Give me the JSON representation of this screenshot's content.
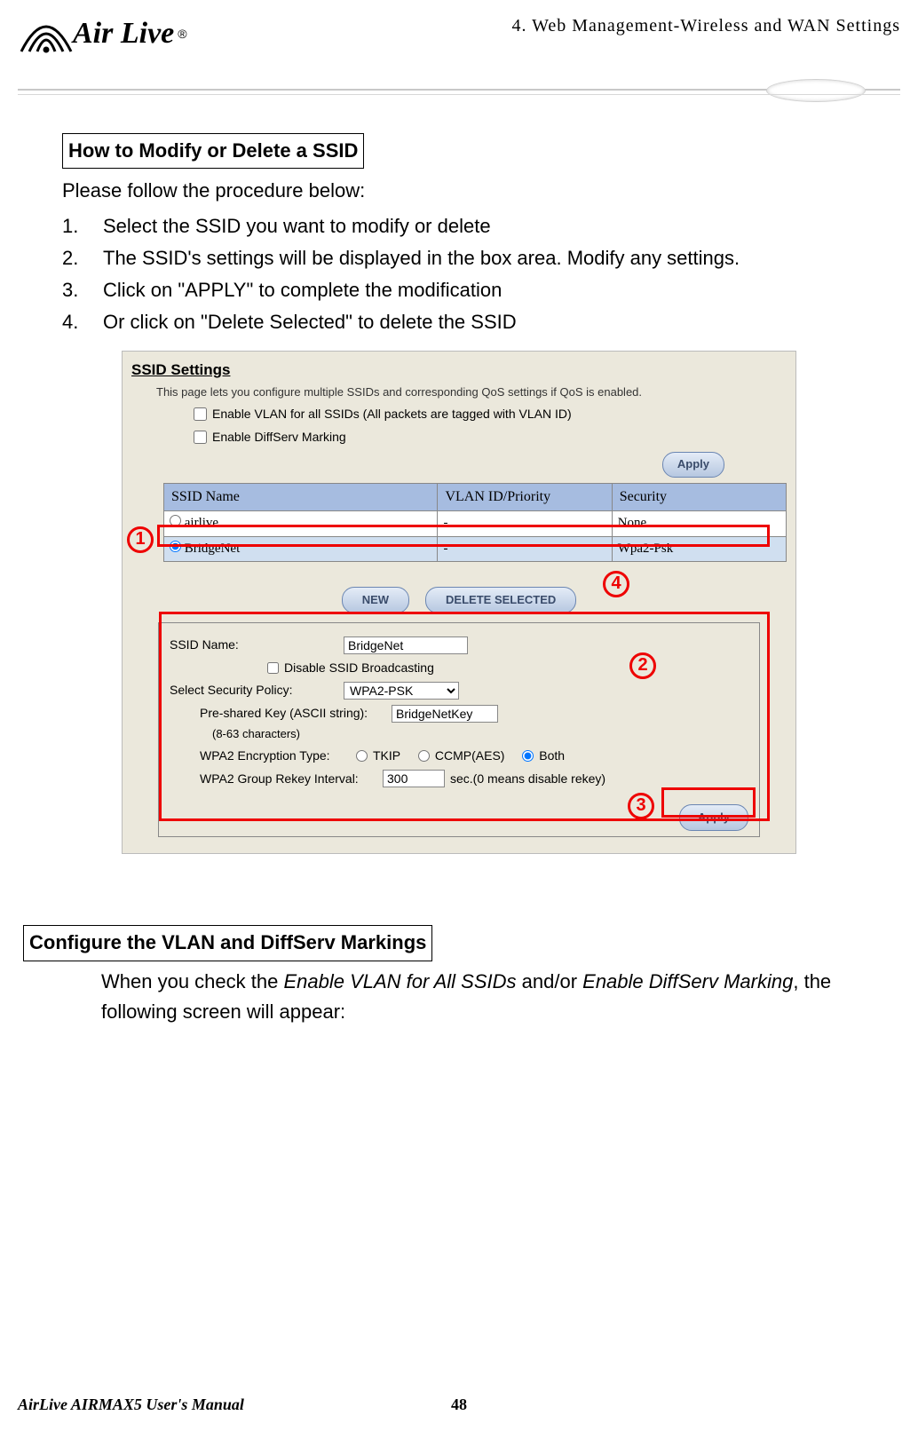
{
  "page": {
    "chapter": "4. Web Management-Wireless and WAN Settings",
    "logo_text": "Air Live",
    "registered": "®"
  },
  "section1": {
    "heading": "How to Modify or Delete a SSID",
    "intro": "Please follow the procedure below:",
    "steps": [
      "Select the SSID you want to modify or delete",
      "The SSID's settings will be displayed in the box area.    Modify any settings.",
      "Click on \"APPLY\" to complete the modification",
      "Or click on \"Delete Selected\" to delete the SSID"
    ]
  },
  "screenshot": {
    "title": "SSID Settings",
    "subtitle": "This page lets you configure multiple SSIDs and corresponding QoS settings if QoS is enabled.",
    "chk_vlan": "Enable VLAN for all SSIDs (All packets are tagged with VLAN ID)",
    "chk_diffserv": "Enable DiffServ Marking",
    "apply_label": "Apply",
    "table": {
      "headers": [
        "SSID  Name",
        "VLAN ID/Priority",
        "Security"
      ],
      "rows": [
        {
          "selected": false,
          "name": "airlive",
          "vlan": "-",
          "sec": "None"
        },
        {
          "selected": true,
          "name": "BridgeNet",
          "vlan": "-",
          "sec": "Wpa2-Psk"
        }
      ]
    },
    "buttons": {
      "new": "NEW",
      "delete": "DELETE SELECTED"
    },
    "form": {
      "ssid_label": "SSID Name:",
      "ssid_value": "BridgeNet",
      "disable_bcast": "Disable SSID Broadcasting",
      "sec_label": "Select Security Policy:",
      "sec_value": "WPA2-PSK",
      "psk_label": "Pre-shared Key (ASCII string):",
      "psk_note": "(8-63 characters)",
      "psk_value": "BridgeNetKey",
      "enc_label": "WPA2 Encryption Type:",
      "enc_tkip": "TKIP",
      "enc_ccmp": "CCMP(AES)",
      "enc_both": "Both",
      "rekey_label": "WPA2 Group Rekey Interval:",
      "rekey_value": "300",
      "rekey_unit": "sec.(0 means disable rekey)",
      "apply": "Apply"
    },
    "annotations": {
      "c1": "1",
      "c2": "2",
      "c3": "3",
      "c4": "4"
    }
  },
  "section2": {
    "heading": "Configure the VLAN and DiffServ Markings",
    "body_pre": "When you check the ",
    "em1": "Enable VLAN for All SSIDs",
    "mid": " and/or ",
    "em2": "Enable DiffServ Marking",
    "body_post": ", the following screen will appear:"
  },
  "footer": {
    "left": "AirLive AIRMAX5 User's Manual",
    "page": "48"
  }
}
